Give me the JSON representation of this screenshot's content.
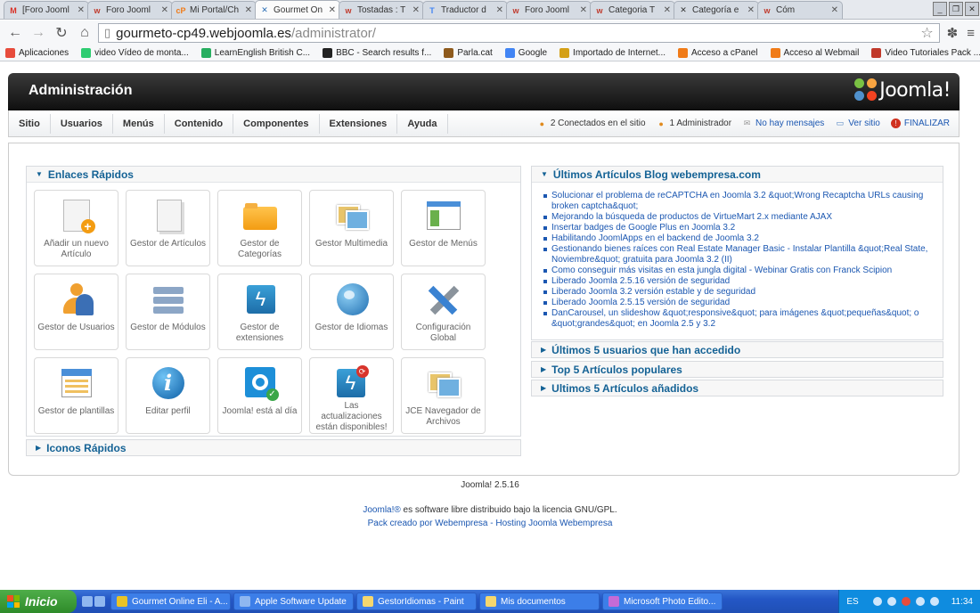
{
  "browser": {
    "tabs": [
      {
        "label": "[Foro Jooml",
        "icon": "gmail-icon",
        "color": "#d93025",
        "letter": "M"
      },
      {
        "label": "Foro Jooml",
        "icon": "webempresa-icon",
        "color": "#c0392b",
        "letter": "w"
      },
      {
        "label": "Mi Portal/Ch",
        "icon": "cpanel-icon",
        "color": "#f07b18",
        "letter": "cP"
      },
      {
        "label": "Gourmet On",
        "icon": "joomla-icon",
        "color": "#2c6fb6",
        "letter": "✕",
        "active": true
      },
      {
        "label": "Tostadas : T",
        "icon": "webempresa-icon",
        "color": "#c0392b",
        "letter": "w"
      },
      {
        "label": "Traductor d",
        "icon": "translate-icon",
        "color": "#4285f4",
        "letter": "T"
      },
      {
        "label": "Foro Jooml",
        "icon": "webempresa-icon",
        "color": "#c0392b",
        "letter": "w"
      },
      {
        "label": "Categoria T",
        "icon": "webempresa-icon",
        "color": "#c0392b",
        "letter": "w"
      },
      {
        "label": "Categoría e",
        "icon": "joomla-icon",
        "color": "#333333",
        "letter": "✕"
      },
      {
        "label": "Cóm",
        "icon": "webempresa-icon",
        "color": "#c0392b",
        "letter": "w"
      }
    ],
    "url_host": "gourmeto-cp49.webjoomla.es",
    "url_path": "/administrator/",
    "bookmarks": [
      {
        "label": "Aplicaciones",
        "icon": "apps-grid-icon",
        "color": "#e74c3c"
      },
      {
        "label": "video Vídeo de monta...",
        "icon": "video-icon",
        "color": "#2ecc71"
      },
      {
        "label": "LearnEnglish  British C...",
        "icon": "learnenglish-icon",
        "color": "#27ae60"
      },
      {
        "label": "BBC - Search results f...",
        "icon": "bbc-icon",
        "color": "#222222"
      },
      {
        "label": "Parla.cat",
        "icon": "parla-icon",
        "color": "#8e5a1c"
      },
      {
        "label": "Google",
        "icon": "google-icon",
        "color": "#4285f4"
      },
      {
        "label": "Importado de Internet...",
        "icon": "folder-icon",
        "color": "#d4a017"
      },
      {
        "label": "Acceso a cPanel",
        "icon": "cpanel-icon",
        "color": "#f07b18"
      },
      {
        "label": "Acceso al Webmail",
        "icon": "cpanel-icon",
        "color": "#f07b18"
      },
      {
        "label": "Video Tutoriales Pack ...",
        "icon": "webempresa-icon",
        "color": "#c0392b"
      }
    ]
  },
  "header": {
    "title": "Administración",
    "logo_text": "Joomla!"
  },
  "menu": {
    "items": [
      "Sitio",
      "Usuarios",
      "Menús",
      "Contenido",
      "Componentes",
      "Extensiones",
      "Ayuda"
    ]
  },
  "status": {
    "online": "2 Conectados en el sitio",
    "admins": "1 Administrador",
    "messages": "No hay mensajes",
    "view_site": "Ver sitio",
    "logout": "FINALIZAR"
  },
  "quick_links": {
    "title": "Enlaces Rápidos",
    "buttons": [
      {
        "label": "Añadir un nuevo Artículo",
        "icon": "add-article-icon"
      },
      {
        "label": "Gestor de Artículos",
        "icon": "article-manager-icon"
      },
      {
        "label": "Gestor de Categorías",
        "icon": "category-folder-icon"
      },
      {
        "label": "Gestor Multimedia",
        "icon": "media-manager-icon"
      },
      {
        "label": "Gestor de Menús",
        "icon": "menu-manager-icon"
      },
      {
        "label": "Gestor de Usuarios",
        "icon": "user-manager-icon"
      },
      {
        "label": "Gestor de Módulos",
        "icon": "module-manager-icon"
      },
      {
        "label": "Gestor de extensiones",
        "icon": "extension-manager-icon"
      },
      {
        "label": "Gestor de Idiomas",
        "icon": "language-globe-icon"
      },
      {
        "label": "Configuración Global",
        "icon": "global-config-icon"
      },
      {
        "label": "Gestor de plantillas",
        "icon": "template-manager-icon"
      },
      {
        "label": "Editar perfil",
        "icon": "edit-profile-icon"
      },
      {
        "label": "Joomla! está al día",
        "icon": "joomla-uptodate-icon"
      },
      {
        "label": "Las actualizaciones están disponibles!",
        "icon": "updates-available-icon"
      },
      {
        "label": "JCE Navegador de Archivos",
        "icon": "jce-file-browser-icon"
      }
    ],
    "footer_title": "Iconos Rápidos"
  },
  "news": {
    "title": "Últimos Artículos Blog webempresa.com",
    "items": [
      "Solucionar el problema de reCAPTCHA en Joomla 3.2 &quot;Wrong Recaptcha URLs causing broken captcha&quot;",
      "Mejorando la búsqueda de productos de VirtueMart 2.x mediante AJAX",
      "Insertar badges de Google Plus en Joomla 3.2",
      "Habilitando JoomlApps en el backend de Joomla 3.2",
      "Gestionando bienes raíces con Real Estate Manager Basic - Instalar Plantilla &quot;Real State, Noviembre&quot; gratuita para Joomla 3.2 (II)",
      "Como conseguir más visitas en esta jungla digital - Webinar Gratis con Franck Scipion",
      "Liberado Joomla 2.5.16 versión de seguridad",
      "Liberado Joomla 3.2 versión estable y de seguridad",
      "Liberado Joomla 2.5.15 versión de seguridad",
      "DanCarousel, un slideshow &quot;responsive&quot; para imágenes &quot;pequeñas&quot; o &quot;grandes&quot; en Joomla 2.5 y 3.2"
    ]
  },
  "panels": {
    "last_users": "Últimos 5 usuarios que han accedido",
    "popular": "Top 5 Artículos populares",
    "added": "Ultimos 5 Artículos añadidos"
  },
  "footer": {
    "version": "Joomla! 2.5.16",
    "license_link": "Joomla!®",
    "license_text": " es software libre distribuido bajo la licencia GNU/GPL.",
    "pack_prefix": "Pack creado por ",
    "pack_link1": "Webempresa",
    "pack_sep": " - ",
    "pack_link2": "Hosting Joomla Webempresa"
  },
  "taskbar": {
    "start_label": "Inicio",
    "tasks": [
      {
        "label": "Gourmet Online Eli - A...",
        "icon": "chrome-icon",
        "color": "#e8c327"
      },
      {
        "label": "Apple Software Update",
        "icon": "apple-update-icon",
        "color": "#8fb7f0"
      },
      {
        "label": "GestorIdiomas - Paint",
        "icon": "paint-icon",
        "color": "#f5d76e"
      },
      {
        "label": "Mis documentos",
        "icon": "folder-icon",
        "color": "#f5d76e"
      },
      {
        "label": "Microsoft Photo Edito...",
        "icon": "photo-editor-icon",
        "color": "#c56bd6"
      }
    ],
    "language": "ES",
    "clock": "11:34"
  }
}
